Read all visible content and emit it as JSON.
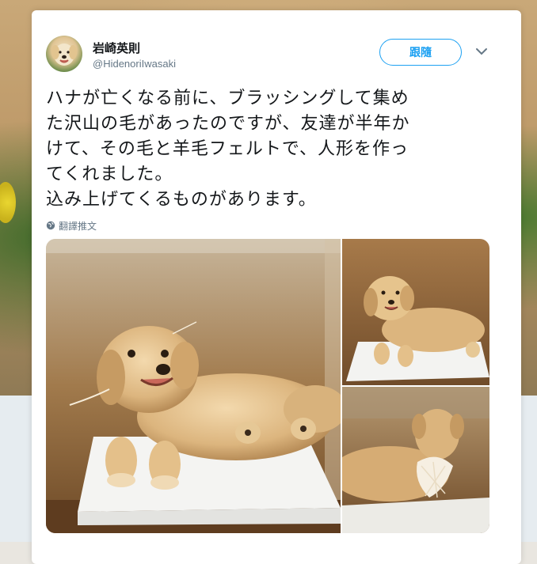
{
  "tweet": {
    "author": {
      "name": "岩崎英則",
      "handle": "@HidenoriIwasaki"
    },
    "follow_label": "跟隨",
    "text_lines": [
      "ハナが亡くなる前に、ブラッシングして集め",
      "た沢山の毛があったのですが、友達が半年か",
      "けて、その毛と羊毛フェルトで、人形を作っ",
      "てくれました。",
      "込み上げてくるものがあります。"
    ],
    "translate_label": "翻譯推文"
  },
  "icons": {
    "avatar": "avatar",
    "menu": "chevron-down-icon",
    "translate": "globe-icon"
  },
  "colors": {
    "accent": "#1da1f2",
    "text": "#14171a",
    "muted": "#657786"
  }
}
